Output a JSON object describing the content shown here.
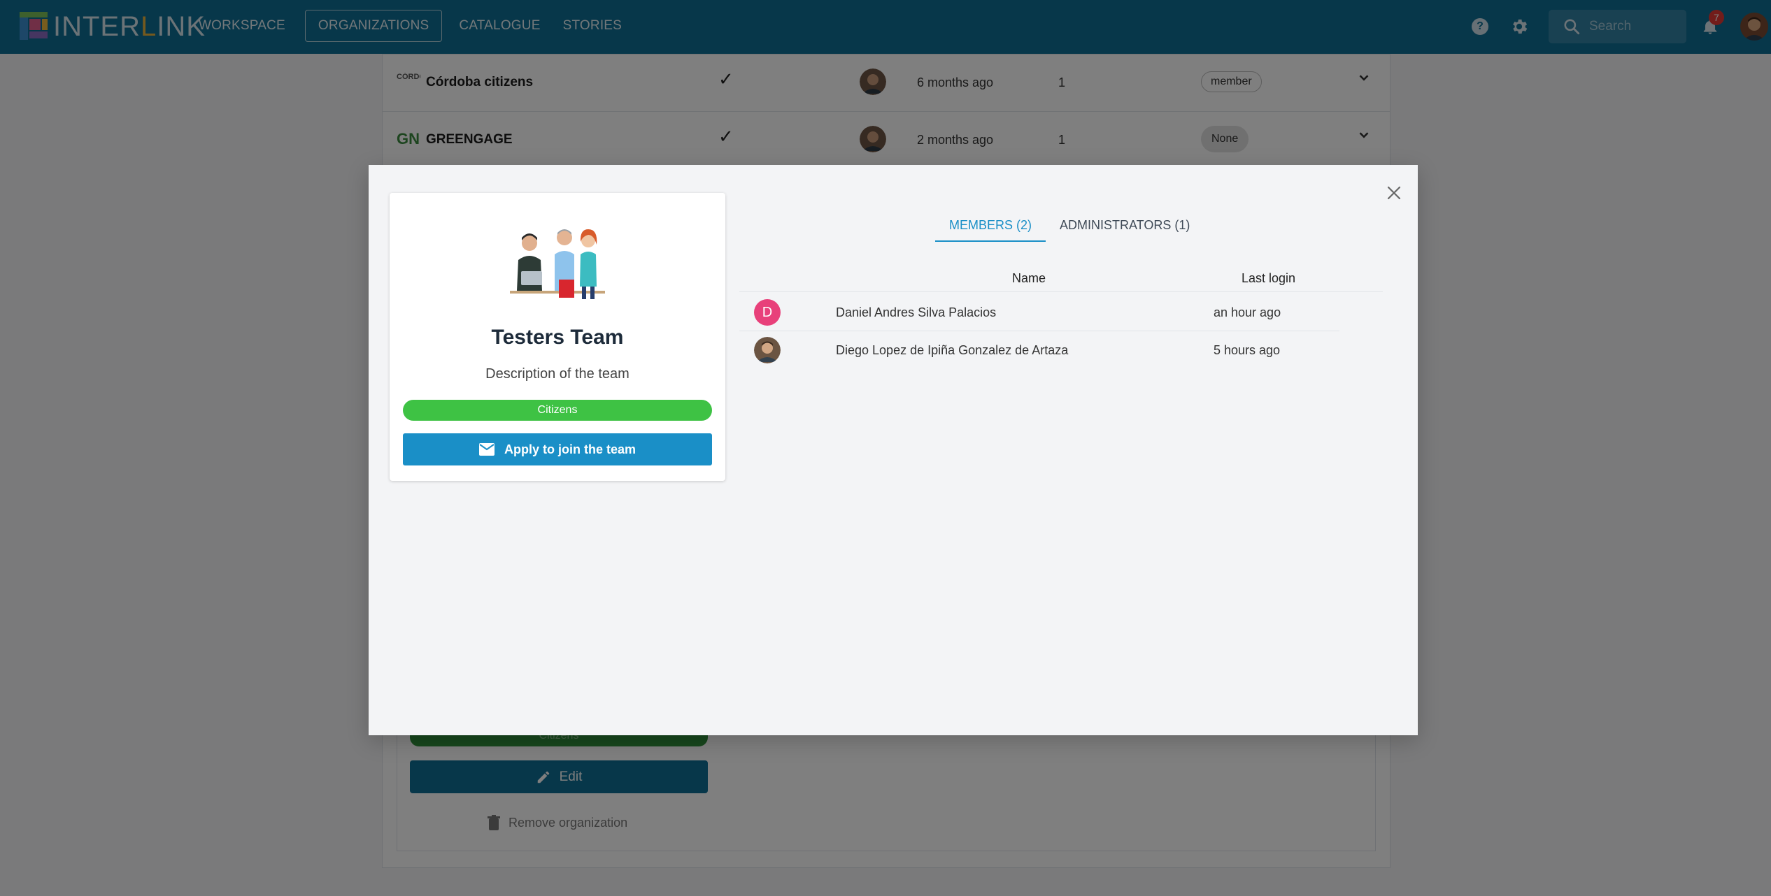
{
  "navbar": {
    "logo_text_a": "INTER",
    "logo_text_b": "L",
    "logo_text_c": "INK",
    "items": [
      {
        "label": "WORKSPACE"
      },
      {
        "label": "ORGANIZATIONS"
      },
      {
        "label": "CATALOGUE"
      },
      {
        "label": "STORIES"
      }
    ],
    "search_placeholder": "Search",
    "notification_count": "7",
    "colors": {
      "bar": "#0f6e94",
      "badge": "#e53935"
    }
  },
  "background": {
    "org_rows": [
      {
        "logo": "CÓRDOBA",
        "name": "Córdoba citizens",
        "check": "✓",
        "time": "6 months ago",
        "count": "1",
        "role": "member"
      },
      {
        "logo": "GN",
        "name": "GREENGAGE",
        "check": "✓",
        "time": "2 months ago",
        "count": "1",
        "role": "None"
      }
    ],
    "tag_label": "Citizens",
    "edit_label": "Edit",
    "remove_label": "Remove organization"
  },
  "modal": {
    "team": {
      "name": "Testers Team",
      "description": "Description of the team",
      "tag": "Citizens",
      "apply_label": "Apply to join the team"
    },
    "tabs": [
      {
        "label": "MEMBERS (2)",
        "active": true
      },
      {
        "label": "ADMINISTRATORS (1)",
        "active": false
      }
    ],
    "table": {
      "headers": {
        "name": "Name",
        "last_login": "Last login"
      },
      "rows": [
        {
          "initial": "D",
          "name": "Daniel Andres Silva Palacios",
          "last_login": "an hour ago"
        },
        {
          "initial": "",
          "name": "Diego Lopez de Ipiña Gonzalez de Artaza",
          "last_login": "5 hours ago"
        }
      ]
    },
    "colors": {
      "accent": "#1a8fc7",
      "tag": "#3ec244",
      "avatar_d": "#e8407a"
    }
  }
}
